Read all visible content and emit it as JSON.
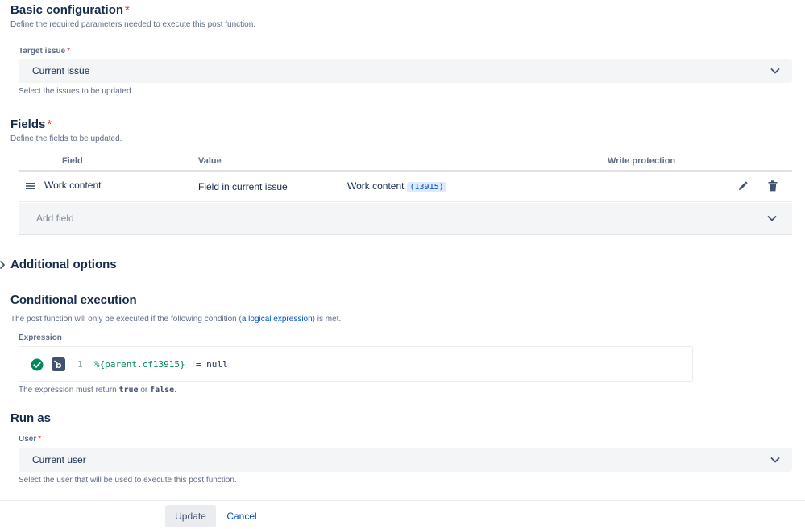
{
  "basic": {
    "title": "Basic configuration",
    "required": "*",
    "description": "Define the required parameters needed to execute this post function.",
    "target_label": "Target issue",
    "target_value": "Current issue",
    "target_help": "Select the issues to be updated."
  },
  "fields": {
    "title": "Fields",
    "required": "*",
    "description": "Define the fields to be updated.",
    "columns": {
      "field": "Field",
      "value": "Value",
      "write_protection": "Write protection"
    },
    "rows": [
      {
        "field": "Work content",
        "value_source": "Field in current issue",
        "value_field": "Work content",
        "value_id": "(13915)"
      }
    ],
    "add_placeholder": "Add field"
  },
  "additional": {
    "title": "Additional options"
  },
  "conditional": {
    "title": "Conditional execution",
    "desc_prefix": "The post function will only be executed if the following condition (",
    "desc_link": "a logical expression",
    "desc_suffix": ") is met.",
    "expression_label": "Expression",
    "line_number": "1",
    "code_var": "%{parent.cf13915}",
    "code_rest": " != null",
    "help_prefix": "The expression must return ",
    "help_true": "true",
    "help_or": " or ",
    "help_false": "false",
    "help_suffix": "."
  },
  "run_as": {
    "title": "Run as",
    "user_label": "User",
    "user_value": "Current user",
    "user_help": "Select the user that will be used to execute this post function."
  },
  "footer": {
    "update_label": "Update",
    "cancel_label": "Cancel"
  },
  "colors": {
    "accent": "#0052cc",
    "required": "#de350b",
    "valid": "#00875a"
  },
  "icons": [
    "chevron-down-icon",
    "drag-handle-icon",
    "pencil-icon",
    "trash-icon",
    "chevron-right-icon",
    "check-circle-icon",
    "code-editor-icon"
  ]
}
